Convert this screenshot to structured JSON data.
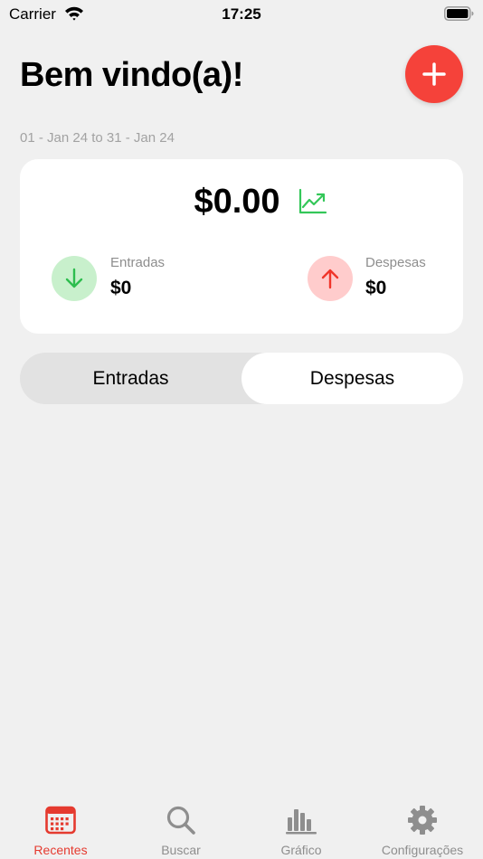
{
  "status_bar": {
    "carrier": "Carrier",
    "time": "17:25"
  },
  "header": {
    "title": "Bem vindo(a)!"
  },
  "date_range": "01 - Jan 24 to 31 - Jan 24",
  "summary": {
    "balance": "$0.00",
    "income": {
      "label": "Entradas",
      "value": "$0"
    },
    "expense": {
      "label": "Despesas",
      "value": "$0"
    }
  },
  "segmented": {
    "options": [
      "Entradas",
      "Despesas"
    ],
    "selected": "Despesas"
  },
  "tab_bar": {
    "items": [
      {
        "label": "Recentes",
        "icon": "calendar-icon",
        "active": true
      },
      {
        "label": "Buscar",
        "icon": "search-icon",
        "active": false
      },
      {
        "label": "Gráfico",
        "icon": "bar-chart-icon",
        "active": false
      },
      {
        "label": "Configurações",
        "icon": "gear-icon",
        "active": false
      }
    ]
  },
  "colors": {
    "accent": "#f5423a",
    "income": "#34c759",
    "expense": "#ff3b30",
    "tab_active": "#e53a2f",
    "tab_inactive": "#8e8e8e"
  }
}
